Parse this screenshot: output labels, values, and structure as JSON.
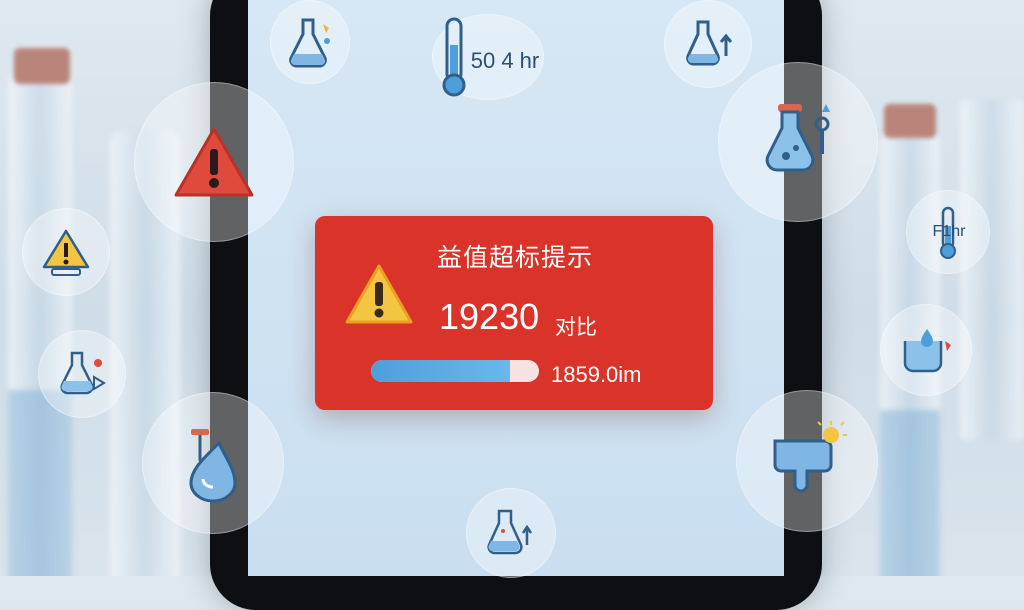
{
  "alert": {
    "title": "益值超标提示",
    "value": "19230",
    "unit": "对比",
    "progress_text": "1859.0im",
    "progress_fraction": 0.83
  },
  "labels": {
    "thermo_reading": "50 4 hr",
    "thermo_small_reading": "F1hr"
  },
  "colors": {
    "alert_bg": "#d9332a",
    "warn_yellow": "#f4c542",
    "warn_red": "#e04a3c",
    "liquid_blue": "#4d9fdc"
  },
  "icons": [
    "flask-drop-icon",
    "thermometer-icon",
    "flask-arrow-icon",
    "warning-triangle-icon",
    "flask-dropper-icon",
    "warning-sign-icon",
    "thermometer-gauge-icon",
    "flask-small-icon",
    "beaker-drop-icon",
    "water-drop-icon",
    "water-tank-icon",
    "flask-bottom-icon"
  ]
}
